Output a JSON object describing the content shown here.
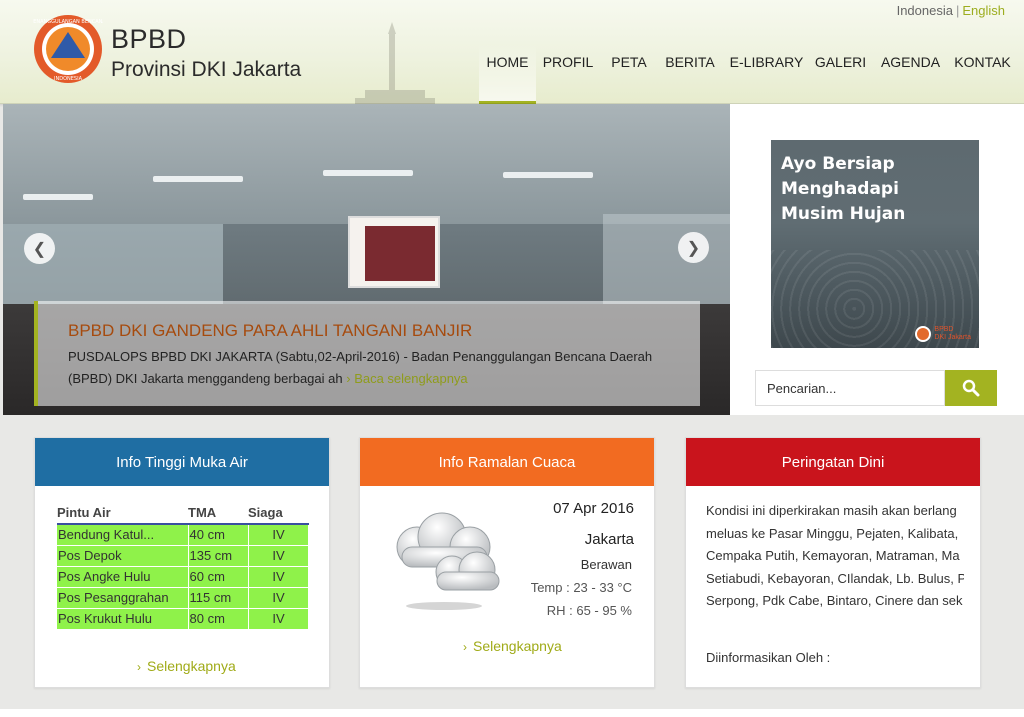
{
  "header": {
    "brand_title": "BPBD",
    "brand_subtitle": "Provinsi DKI Jakarta",
    "lang_id": "Indonesia",
    "lang_sep": "|",
    "lang_en": "English"
  },
  "nav": [
    {
      "label": "HOME",
      "active": true
    },
    {
      "label": "PROFIL"
    },
    {
      "label": "PETA"
    },
    {
      "label": "BERITA"
    },
    {
      "label": "E-LIBRARY"
    },
    {
      "label": "GALERI"
    },
    {
      "label": "AGENDA"
    },
    {
      "label": "KONTAK"
    }
  ],
  "slider": {
    "title": "BPBD DKI GANDENG PARA AHLI TANGANI BANJIR",
    "text": "PUSDALOPS BPBD DKI JAKARTA (Sabtu,02-April-2016) - Badan Penanggulangan Bencana Daerah (BPBD) DKI Jakarta menggandeng berbagai ah",
    "more": "Baca selengkapnya"
  },
  "banner": {
    "line1": "Ayo Bersiap",
    "line2": "Menghadapi",
    "line3": "Musim Hujan",
    "logo_line1": "BPBD",
    "logo_line2": "DKI Jakarta"
  },
  "search": {
    "placeholder": "Pencarian..."
  },
  "water": {
    "title": "Info Tinggi Muka Air",
    "headers": [
      "Pintu Air",
      "TMA",
      "Siaga"
    ],
    "rows": [
      [
        "Bendung Katul...",
        "40 cm",
        "IV"
      ],
      [
        "Pos Depok",
        "135 cm",
        "IV"
      ],
      [
        "Pos Angke Hulu",
        "60 cm",
        "IV"
      ],
      [
        "Pos Pesanggrahan",
        "115 cm",
        "IV"
      ],
      [
        "Pos Krukut Hulu",
        "80 cm",
        "IV"
      ]
    ],
    "more": "Selengkapnya"
  },
  "weather": {
    "title": "Info Ramalan Cuaca",
    "date": "07 Apr 2016",
    "city": "Jakarta",
    "condition": "Berawan",
    "temp": "Temp : 23 - 33 °C",
    "rh": "RH   : 65 - 95 %",
    "more": "Selengkapnya",
    "icon": "cloud-icon"
  },
  "warning": {
    "title": "Peringatan Dini",
    "lines": [
      "Kondisi ini diperkirakan masih akan berlang",
      "meluas ke  Pasar Minggu, Pejaten, Kalibata,",
      "Cempaka Putih, Kemayoran, Matraman,  Ma",
      "Setiabudi, Kebayoran, CIlandak, Lb. Bulus, P",
      "Serpong, Pdk Cabe,  Bintaro, Cinere dan sek"
    ],
    "info": "Diinformasikan Oleh :"
  },
  "colors": {
    "accent": "#a3b321",
    "water_panel": "#1f6ea3",
    "weather_panel": "#f26b21",
    "warning_panel": "#c9141c",
    "table_fill": "#8ff24a"
  }
}
